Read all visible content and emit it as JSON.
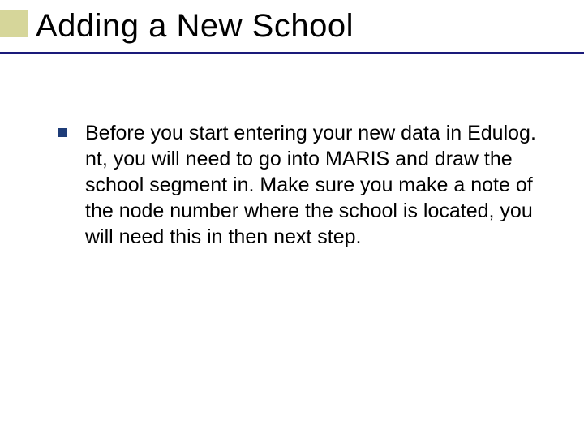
{
  "slide": {
    "title": "Adding a New School",
    "bullets": [
      {
        "text": "Before you start entering your new data in Edulog. nt, you will need to go into MARIS and draw the school segment in. Make sure you make a note of the node number where the school is located, you will need this in then next step."
      }
    ]
  }
}
